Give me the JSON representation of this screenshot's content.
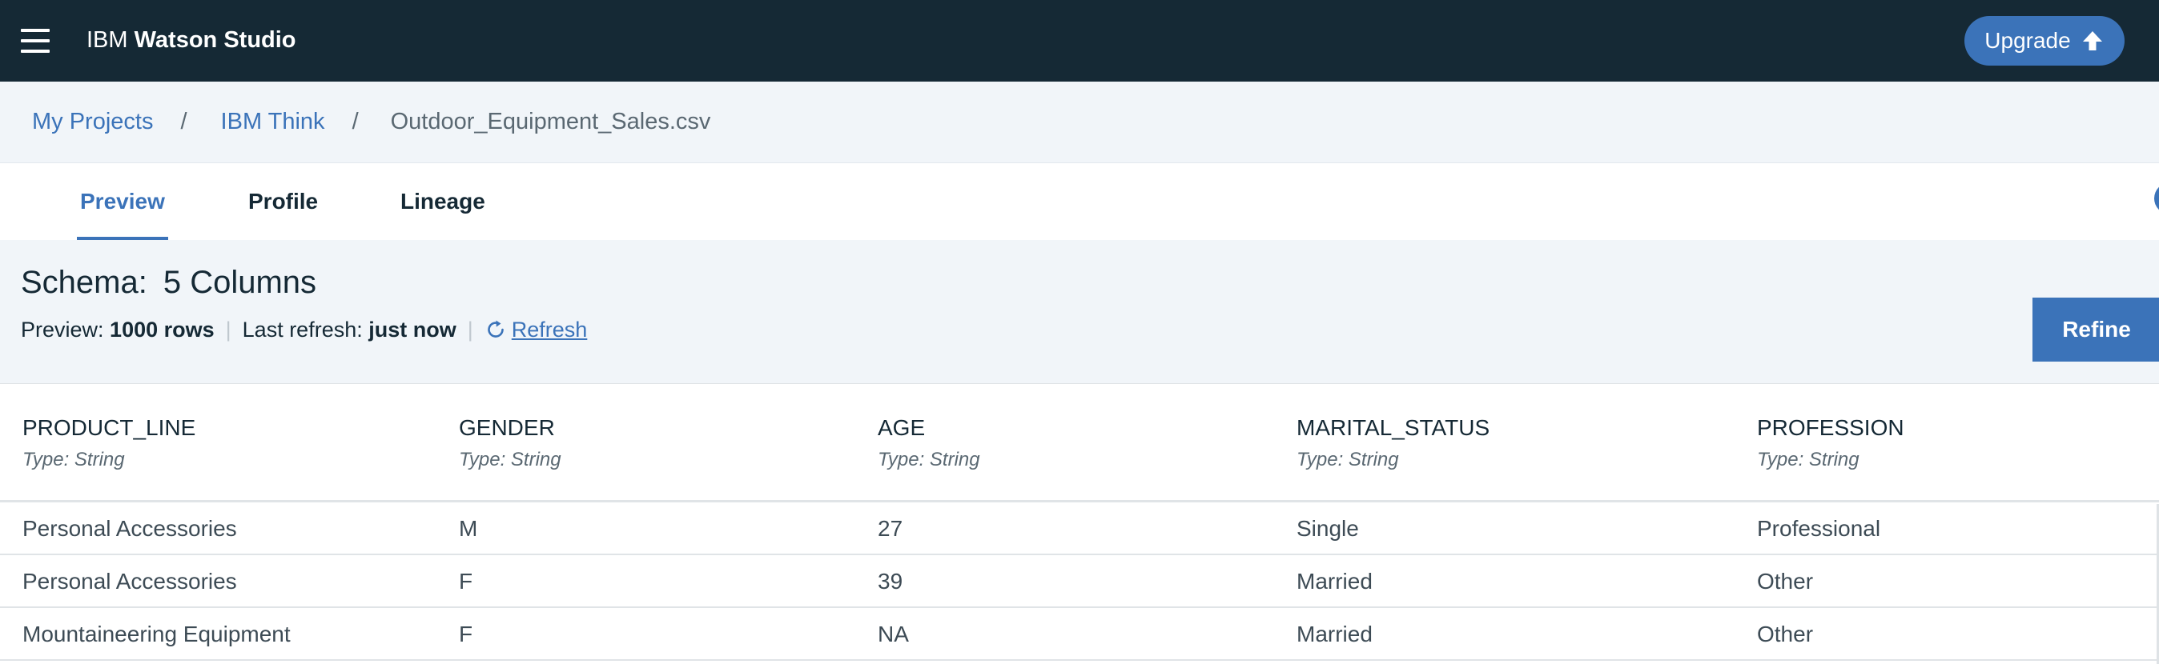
{
  "header": {
    "brand_prefix": "IBM",
    "brand_name": "Watson Studio",
    "upgrade_label": "Upgrade"
  },
  "breadcrumb": {
    "items": [
      "My Projects",
      "IBM Think"
    ],
    "separator": "/",
    "current": "Outdoor_Equipment_Sales.csv"
  },
  "tabs": [
    {
      "label": "Preview",
      "active": true
    },
    {
      "label": "Profile",
      "active": false
    },
    {
      "label": "Lineage",
      "active": false
    }
  ],
  "schema": {
    "title_label": "Schema:",
    "title_value": "5 Columns",
    "preview_label": "Preview:",
    "preview_value": "1000 rows",
    "refresh_label": "Last refresh:",
    "refresh_value": "just now",
    "refresh_link": "Refresh",
    "refine_label": "Refine"
  },
  "table": {
    "columns": [
      {
        "name": "PRODUCT_LINE",
        "type": "Type: String"
      },
      {
        "name": "GENDER",
        "type": "Type: String"
      },
      {
        "name": "AGE",
        "type": "Type: String"
      },
      {
        "name": "MARITAL_STATUS",
        "type": "Type: String"
      },
      {
        "name": "PROFESSION",
        "type": "Type: String"
      }
    ],
    "rows": [
      [
        "Personal Accessories",
        "M",
        "27",
        "Single",
        "Professional"
      ],
      [
        "Personal Accessories",
        "F",
        "39",
        "Married",
        "Other"
      ],
      [
        "Mountaineering Equipment",
        "F",
        "NA",
        "Married",
        "Other"
      ]
    ]
  },
  "colors": {
    "topbar": "#152935",
    "accent": "#3b73b9",
    "subtle_bg": "#f1f5f9"
  },
  "icons": {
    "menu": "hamburger-icon",
    "upgrade": "arrow-up-icon",
    "refresh": "refresh-icon"
  }
}
